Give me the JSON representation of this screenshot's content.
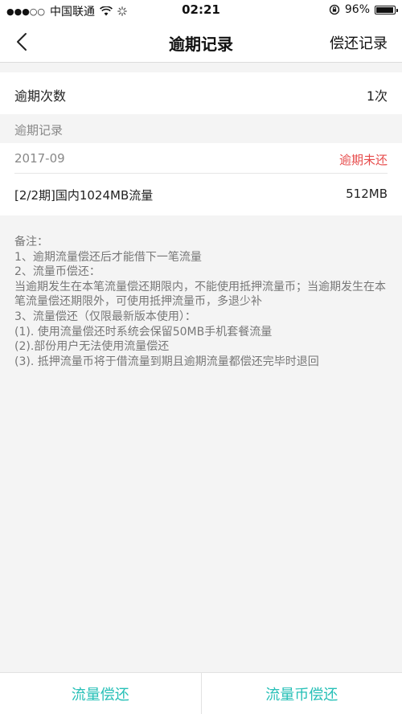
{
  "status_bar": {
    "carrier": "中国联通",
    "time": "02:21",
    "battery": "96%",
    "battery_level": 0.96
  },
  "nav": {
    "title": "逾期记录",
    "right_label": "偿还记录"
  },
  "overdue_count": {
    "label": "逾期次数",
    "value": "1次"
  },
  "records_section": {
    "title": "逾期记录"
  },
  "records": [
    {
      "date": "2017-09",
      "status": "逾期未还",
      "item": "[2/2期]国内1024MB流量",
      "size": "512MB"
    }
  ],
  "notes": {
    "title": "备注：",
    "lines": [
      "1、逾期流量偿还后才能借下一笔流量",
      "2、流量币偿还：",
      "当逾期发生在本笔流量偿还期限内，不能使用抵押流量币；当逾期发生在本笔流量偿还期限外，可使用抵押流量币，多退少补",
      "3、流量偿还（仅限最新版本使用）：",
      "(1). 使用流量偿还时系统会保留50MB手机套餐流量",
      "(2).部份用户无法使用流量偿还",
      "(3). 抵押流量币将于借流量到期且逾期流量都偿还完毕时退回"
    ]
  },
  "bottom": {
    "left_label": "流量偿还",
    "right_label": "流量币偿还"
  },
  "colors": {
    "accent": "#27c0b7",
    "overdue_red": "#e74c4c"
  }
}
